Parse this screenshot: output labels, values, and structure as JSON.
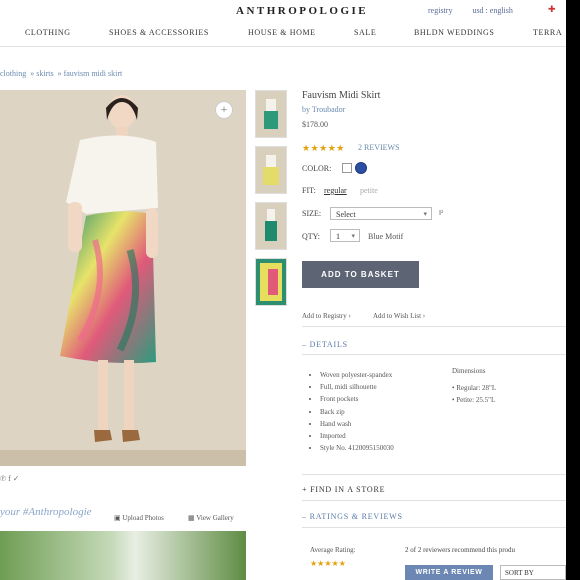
{
  "header": {
    "logo": "ANTHROPOLOGIE",
    "registry": "registry",
    "locale": "usd : english",
    "nav": [
      "CLOTHING",
      "SHOES & ACCESSORIES",
      "HOUSE & HOME",
      "SALE",
      "BHLDN WEDDINGS",
      "TERRA"
    ]
  },
  "breadcrumbs": [
    "clothing",
    "skirts",
    "fauvism midi skirt"
  ],
  "product": {
    "title": "Fauvism Midi Skirt",
    "brand": "by Troubador",
    "price": "$178.00",
    "stars": "★★★★★",
    "review_count": "2 REVIEWS",
    "color_label": "COLOR:",
    "fit_label": "FIT:",
    "fit_selected": "regular",
    "fit_other": "petite",
    "size_label": "SIZE:",
    "size_value": "Select",
    "size_icon": "ruler-icon",
    "qty_label": "QTY:",
    "qty_value": "1",
    "blue_motif": "Blue Motif",
    "add_to_basket": "ADD TO BASKET",
    "add_registry": "Add to Registry ›",
    "add_wishlist": "Add to Wish List ›"
  },
  "details": {
    "heading": "DETAILS",
    "items": [
      "Woven polyester-spandex",
      "Full, midi silhouette",
      "Front pockets",
      "Back zip",
      "Hand wash",
      "Imported",
      "Style No. 4120095150030"
    ],
    "dimensions_heading": "Dimensions",
    "dimensions": [
      "Regular: 28\"L",
      "Petite: 25.5\"L"
    ]
  },
  "sections": {
    "find_store": "FIND IN A STORE",
    "ratings": "RATINGS & REVIEWS"
  },
  "ratings": {
    "average_label": "Average Rating:",
    "average_stars": "★★★★★",
    "recommend": "2 of 2 reviewers recommend this produ",
    "write_review": "WRITE A REVIEW",
    "sort_by": "SORT BY"
  },
  "community": {
    "heading": "your #Anthropologie",
    "upload": "Upload Photos",
    "gallery": "View Gallery"
  },
  "colors": {
    "accent": "#6a8ab0",
    "button": "#5d6575",
    "star": "#e4a10c",
    "selected_color": "#2d4fa1"
  }
}
